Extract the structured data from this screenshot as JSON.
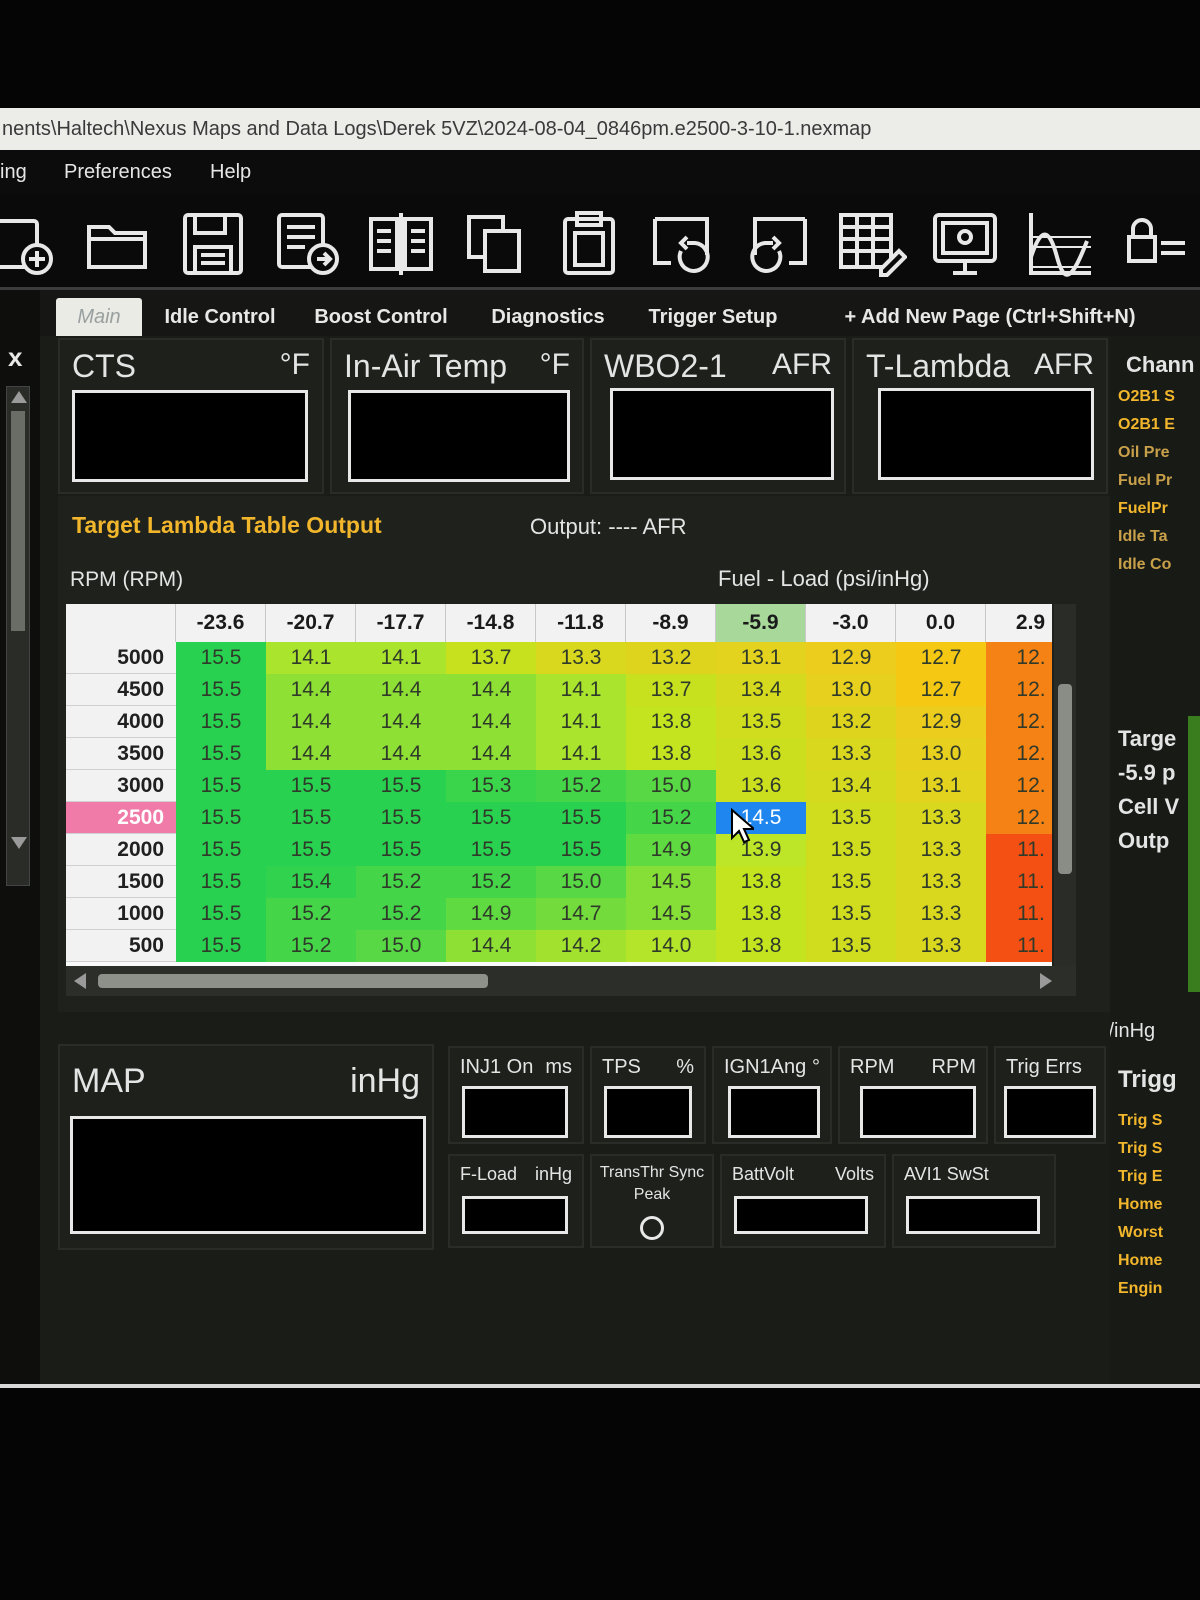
{
  "window": {
    "title": "nents\\Haltech\\Nexus Maps and Data Logs\\Derek 5VZ\\2024-08-04_0846pm.e2500-3-10-1.nexmap"
  },
  "menu": {
    "items": [
      "ing",
      "Preferences",
      "Help"
    ]
  },
  "toolbar": {
    "icons": [
      "new-map-icon",
      "open-folder-icon",
      "save-icon",
      "save-as-icon",
      "compare-icon",
      "copy-icon",
      "clipboard-icon",
      "undo-icon",
      "redo-icon",
      "table-edit-icon",
      "ecu-connect-icon",
      "graph-icon",
      "lock-icon"
    ]
  },
  "left_strip": {
    "close_label": "x"
  },
  "tabs": [
    {
      "label": "Main",
      "active": true
    },
    {
      "label": "Idle Control"
    },
    {
      "label": "Boost Control"
    },
    {
      "label": "Diagnostics"
    },
    {
      "label": "Trigger Setup"
    },
    {
      "label": "+ Add New Page (Ctrl+Shift+N)"
    }
  ],
  "gauges": [
    {
      "label": "CTS",
      "unit": "°F"
    },
    {
      "label": "In-Air Temp",
      "unit": "°F"
    },
    {
      "label": "WBO2-1",
      "unit": "AFR"
    },
    {
      "label": "T-Lambda",
      "unit": "AFR"
    }
  ],
  "map": {
    "title": "Target Lambda Table Output",
    "output": "Output: ---- AFR",
    "y_axis_label": "RPM (RPM)",
    "x_axis_label": "Fuel - Load (psi/inHg)",
    "columns": [
      "-23.6",
      "-20.7",
      "-17.7",
      "-14.8",
      "-11.8",
      "-8.9",
      "-5.9",
      "-3.0",
      "0.0",
      "2.9"
    ],
    "rows": [
      "5000",
      "4500",
      "4000",
      "3500",
      "3000",
      "2500",
      "2000",
      "1500",
      "1000",
      "500"
    ],
    "active_row": "2500",
    "active_col": "-5.9",
    "selected_cell": {
      "row": "2500",
      "col": "-5.9"
    },
    "values": [
      [
        "15.5",
        "14.1",
        "14.1",
        "13.7",
        "13.3",
        "13.2",
        "13.1",
        "12.9",
        "12.7",
        "12."
      ],
      [
        "15.5",
        "14.4",
        "14.4",
        "14.4",
        "14.1",
        "13.7",
        "13.4",
        "13.0",
        "12.7",
        "12."
      ],
      [
        "15.5",
        "14.4",
        "14.4",
        "14.4",
        "14.1",
        "13.8",
        "13.5",
        "13.2",
        "12.9",
        "12."
      ],
      [
        "15.5",
        "14.4",
        "14.4",
        "14.4",
        "14.1",
        "13.8",
        "13.6",
        "13.3",
        "13.0",
        "12."
      ],
      [
        "15.5",
        "15.5",
        "15.5",
        "15.3",
        "15.2",
        "15.0",
        "13.6",
        "13.4",
        "13.1",
        "12."
      ],
      [
        "15.5",
        "15.5",
        "15.5",
        "15.5",
        "15.5",
        "15.2",
        "14.5",
        "13.5",
        "13.3",
        "12."
      ],
      [
        "15.5",
        "15.5",
        "15.5",
        "15.5",
        "15.5",
        "14.9",
        "13.9",
        "13.5",
        "13.3",
        "11."
      ],
      [
        "15.5",
        "15.4",
        "15.2",
        "15.2",
        "15.0",
        "14.5",
        "13.8",
        "13.5",
        "13.3",
        "11."
      ],
      [
        "15.5",
        "15.2",
        "15.2",
        "14.9",
        "14.7",
        "14.5",
        "13.8",
        "13.5",
        "13.3",
        "11."
      ],
      [
        "15.5",
        "15.2",
        "15.0",
        "14.4",
        "14.2",
        "14.0",
        "13.8",
        "13.5",
        "13.3",
        "11."
      ]
    ]
  },
  "side_panel": {
    "channels_title": "Chann",
    "channels": [
      {
        "label": "O2B1 S",
        "color": "#f2b62c"
      },
      {
        "label": "O2B1 E",
        "color": "#f2b62c"
      },
      {
        "label": "Oil Pre",
        "color": "#c9a04a"
      },
      {
        "label": "Fuel Pr",
        "color": "#c9a04a"
      },
      {
        "label": "FuelPr",
        "color": "#f2b62c"
      },
      {
        "label": "Idle Ta",
        "color": "#c9a04a"
      },
      {
        "label": "Idle Co",
        "color": "#c9a04a"
      }
    ],
    "target_lines": [
      "Targe",
      "-5.9 p",
      "Cell V",
      "Outp"
    ],
    "unit_label": "i/inHg",
    "trigger_title": "Trigg",
    "trigger_items": [
      "Trig S",
      "Trig S",
      "Trig E",
      "Home",
      "Worst",
      "Home",
      "Engin"
    ]
  },
  "bottom": {
    "map_gauge": {
      "label": "MAP",
      "unit": "inHg"
    },
    "small": [
      {
        "label": "INJ1 On",
        "unit": "ms"
      },
      {
        "label": "TPS",
        "unit": "%"
      },
      {
        "label": "IGN1Ang",
        "unit": "°"
      },
      {
        "label": "RPM",
        "unit": "RPM"
      },
      {
        "label": "Trig Errs",
        "unit": ""
      }
    ],
    "small2": [
      {
        "label": "F-Load",
        "unit": "inHg"
      },
      {
        "label": "BattVolt",
        "unit": "Volts"
      },
      {
        "label": "AVI1 SwSt",
        "unit": ""
      }
    ],
    "trans_label_1": "TransThr Sync",
    "trans_label_2": "Peak"
  }
}
